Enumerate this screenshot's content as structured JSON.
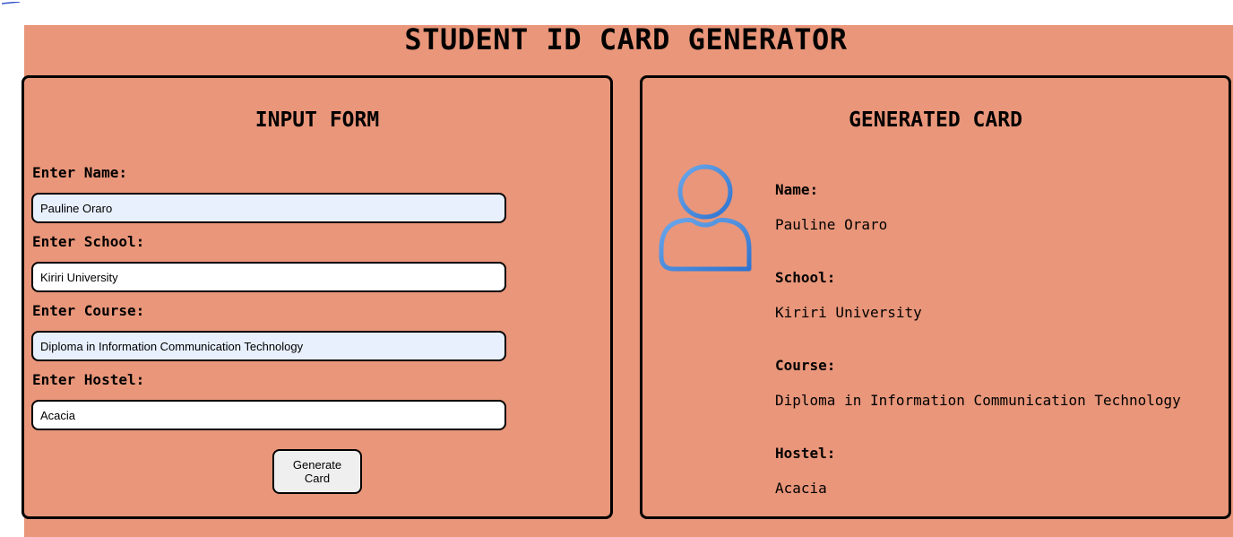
{
  "page_title": "STUDENT ID CARD GENERATOR",
  "colors": {
    "background": "#e9967a",
    "autofill_field": "#e8f0fe",
    "avatar_stroke": "#4a90e2"
  },
  "form": {
    "title": "INPUT FORM",
    "name_label": "Enter Name:",
    "name_value": "Pauline Oraro",
    "school_label": "Enter School:",
    "school_value": "Kiriri University",
    "course_label": "Enter Course:",
    "course_value": "Diploma in Information Communication Technology",
    "hostel_label": "Enter Hostel:",
    "hostel_value": "Acacia",
    "button_label": "Generate Card"
  },
  "card": {
    "title": "GENERATED CARD",
    "avatar_icon": "user-avatar-icon",
    "name_label": "Name:",
    "name_value": "Pauline Oraro",
    "school_label": "School:",
    "school_value": "Kiriri University",
    "course_label": "Course:",
    "course_value": "Diploma in Information Communication Technology",
    "hostel_label": "Hostel:",
    "hostel_value": "Acacia"
  }
}
